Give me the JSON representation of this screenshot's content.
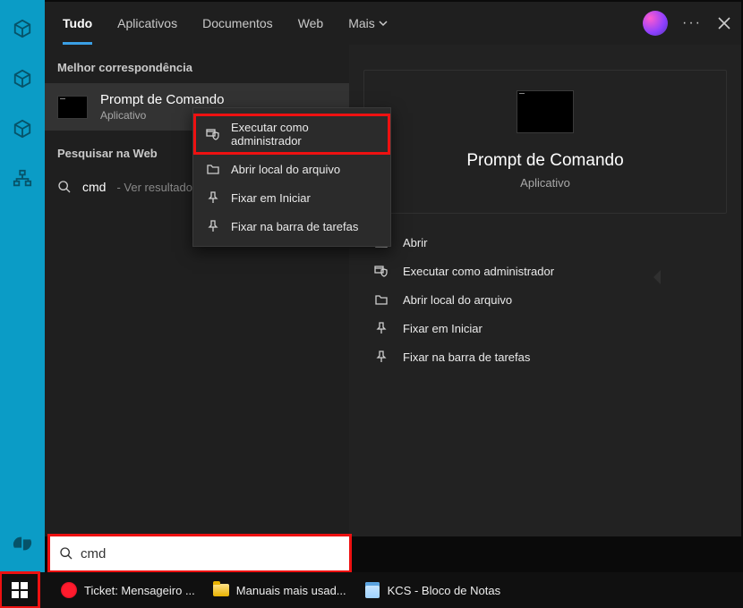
{
  "tabs": {
    "all": "Tudo",
    "apps": "Aplicativos",
    "docs": "Documentos",
    "web": "Web",
    "more": "Mais"
  },
  "left": {
    "best_match_label": "Melhor correspondência",
    "item_title": "Prompt de Comando",
    "item_sub": "Aplicativo",
    "web_section_label": "Pesquisar na Web",
    "web_query": "cmd",
    "web_suffix": " - Ver resultados"
  },
  "context_menu": {
    "run_admin": "Executar como administrador",
    "open_location": "Abrir local do arquivo",
    "pin_start": "Fixar em Iniciar",
    "pin_taskbar": "Fixar na barra de tarefas"
  },
  "detail": {
    "title": "Prompt de Comando",
    "sub": "Aplicativo",
    "open": "Abrir",
    "run_admin": "Executar como administrador",
    "open_location": "Abrir local do arquivo",
    "pin_start": "Fixar em Iniciar",
    "pin_taskbar": "Fixar na barra de tarefas"
  },
  "search": {
    "value": "cmd"
  },
  "taskbar": {
    "opera": "Ticket: Mensageiro ...",
    "folder": "Manuais mais usad...",
    "notepad": "KCS - Bloco de Notas"
  }
}
